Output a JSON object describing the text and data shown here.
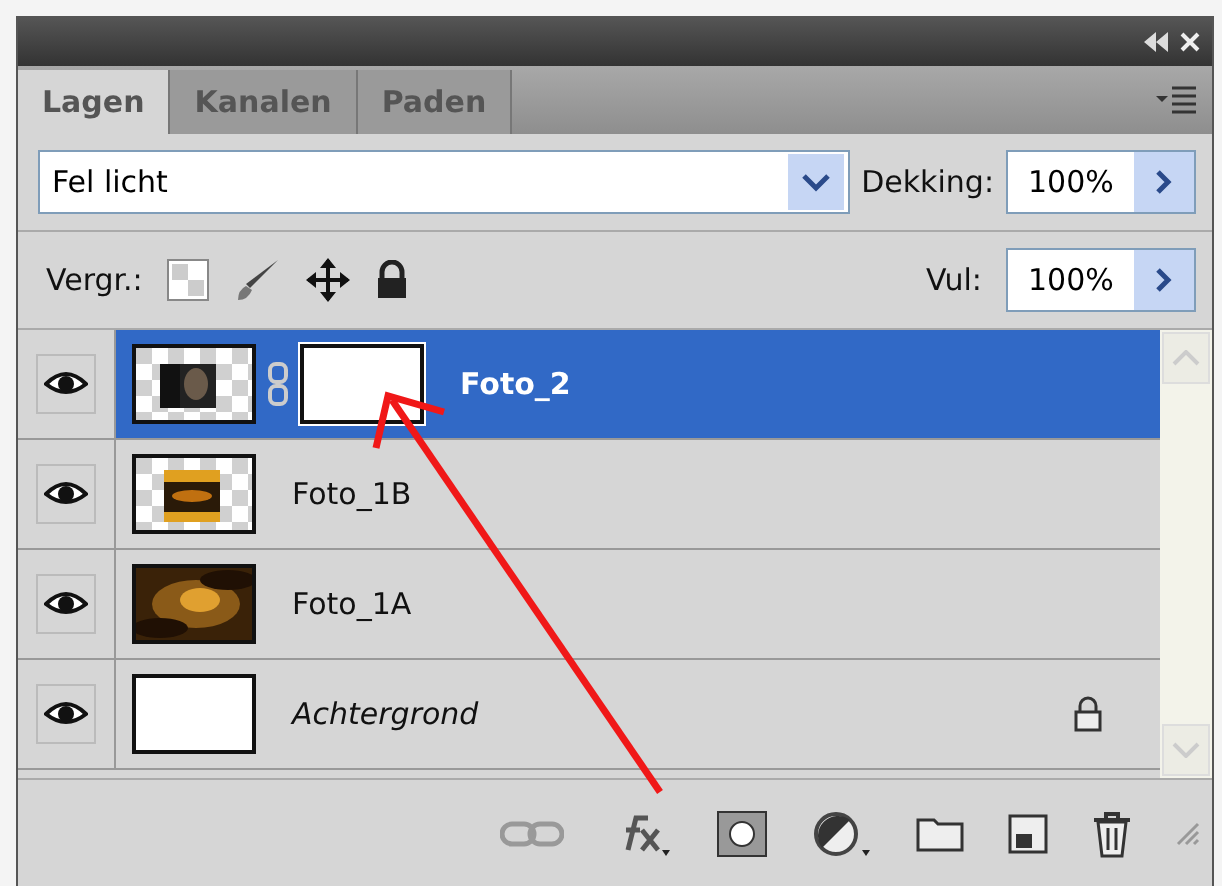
{
  "tabs": [
    {
      "label": "Lagen",
      "selected": true
    },
    {
      "label": "Kanalen",
      "selected": false
    },
    {
      "label": "Paden",
      "selected": false
    }
  ],
  "blend_mode": {
    "value": "Fel licht"
  },
  "opacity": {
    "label": "Dekking:",
    "value": "100%"
  },
  "lock": {
    "label": "Vergr.:"
  },
  "fill": {
    "label": "Vul:",
    "value": "100%"
  },
  "layers": [
    {
      "name": "Foto_2",
      "kind": "masked",
      "selected": true,
      "visible": true,
      "locked": false
    },
    {
      "name": "Foto_1B",
      "kind": "transparent",
      "selected": false,
      "visible": true,
      "locked": false
    },
    {
      "name": "Foto_1A",
      "selected": false,
      "visible": true,
      "locked": false
    },
    {
      "name": "Achtergrond",
      "kind": "background",
      "selected": false,
      "visible": true,
      "locked": true
    }
  ]
}
